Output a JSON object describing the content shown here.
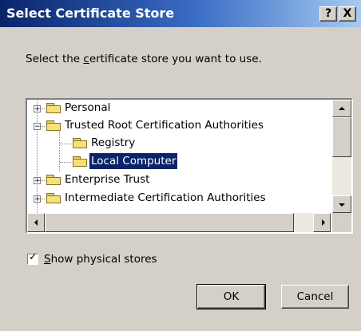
{
  "dialog": {
    "title": "Select Certificate Store",
    "help_button": "?",
    "close_button": "X"
  },
  "prompt": {
    "pre": "Select the ",
    "accel": "c",
    "post": "ertificate store you want to use."
  },
  "tree": {
    "items": [
      {
        "label": "Personal",
        "expander": "+"
      },
      {
        "label": "Trusted Root Certification Authorities",
        "expander": "−"
      },
      {
        "label": "Registry"
      },
      {
        "label": "Local Computer",
        "selected": true
      },
      {
        "label": "Enterprise Trust",
        "expander": "+"
      },
      {
        "label": "Intermediate Certification Authorities",
        "expander": "+"
      }
    ]
  },
  "checkbox": {
    "accel": "S",
    "rest": "how physical stores",
    "checked": true,
    "mark": "✓"
  },
  "buttons": {
    "ok": "OK",
    "cancel": "Cancel"
  },
  "colors": {
    "title_start": "#0a246a",
    "title_end": "#a6caf0",
    "face": "#d4d0c8",
    "selection": "#0a246a"
  }
}
